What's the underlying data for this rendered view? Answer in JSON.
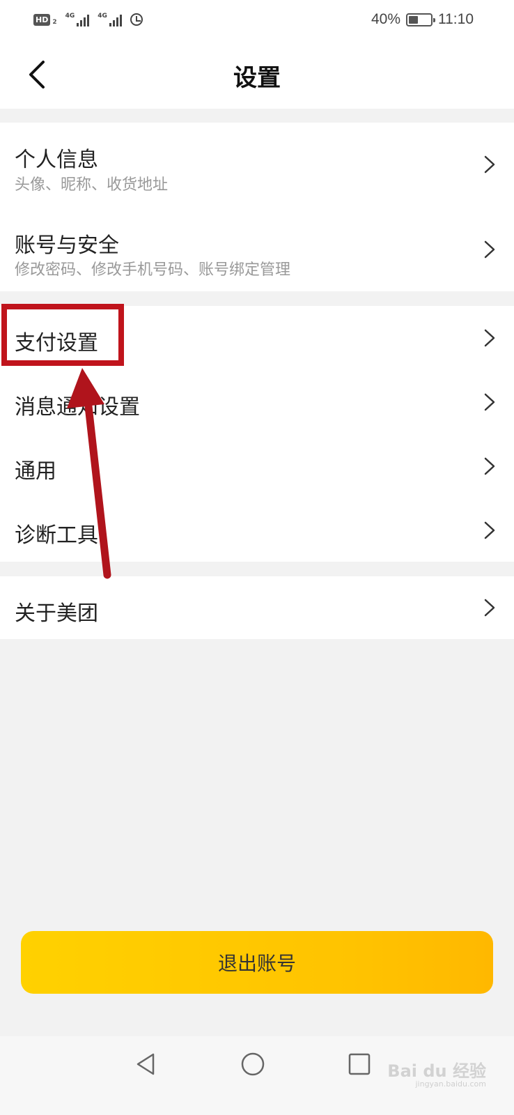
{
  "status_bar": {
    "hd_label": "HD",
    "hd_sub": "2",
    "network_1": "4G",
    "network_2": "4G",
    "battery_percent": "40%",
    "time": "11:10"
  },
  "header": {
    "title": "设置"
  },
  "groups": [
    {
      "items": [
        {
          "title": "个人信息",
          "subtitle": "头像、昵称、收货地址"
        },
        {
          "title": "账号与安全",
          "subtitle": "修改密码、修改手机号码、账号绑定管理"
        }
      ]
    },
    {
      "items": [
        {
          "title": "支付设置"
        },
        {
          "title": "消息通知设置"
        },
        {
          "title": "通用"
        },
        {
          "title": "诊断工具"
        }
      ]
    },
    {
      "items": [
        {
          "title": "关于美团"
        }
      ]
    }
  ],
  "logout": {
    "label": "退出账号"
  },
  "watermark": {
    "text": "Bai du 经验",
    "sub": "jingyan.baidu.com"
  },
  "colors": {
    "accent_yellow": "#ffc300",
    "annotation_red": "#c0141c",
    "background": "#f2f2f2"
  },
  "icons": [
    "back-icon",
    "chevron-right-icon",
    "nav-back-icon",
    "nav-home-icon",
    "nav-recent-icon",
    "alarm-icon",
    "battery-icon",
    "signal-icon"
  ]
}
